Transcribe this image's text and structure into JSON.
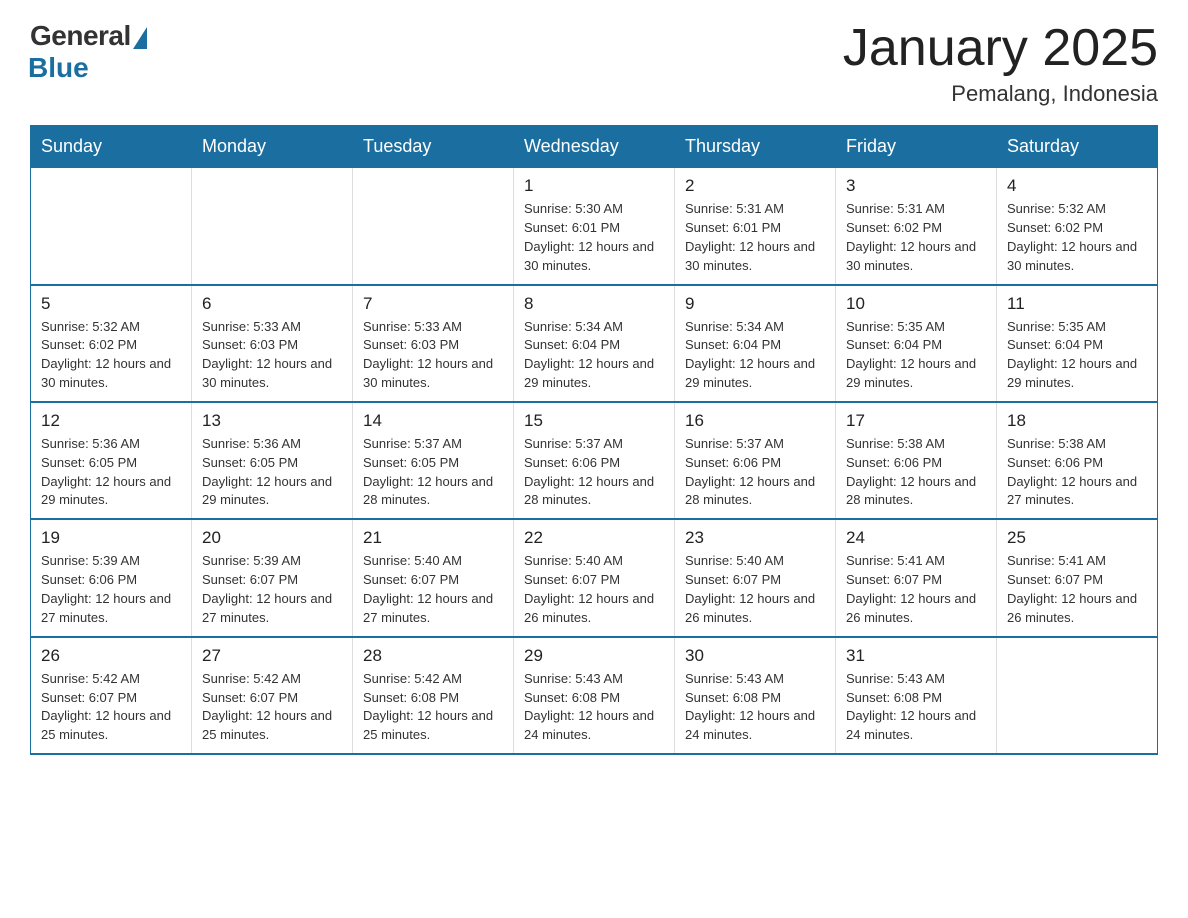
{
  "header": {
    "logo": {
      "general": "General",
      "blue": "Blue"
    },
    "title": "January 2025",
    "location": "Pemalang, Indonesia"
  },
  "calendar": {
    "days_of_week": [
      "Sunday",
      "Monday",
      "Tuesday",
      "Wednesday",
      "Thursday",
      "Friday",
      "Saturday"
    ],
    "weeks": [
      [
        {
          "day": "",
          "info": ""
        },
        {
          "day": "",
          "info": ""
        },
        {
          "day": "",
          "info": ""
        },
        {
          "day": "1",
          "info": "Sunrise: 5:30 AM\nSunset: 6:01 PM\nDaylight: 12 hours and 30 minutes."
        },
        {
          "day": "2",
          "info": "Sunrise: 5:31 AM\nSunset: 6:01 PM\nDaylight: 12 hours and 30 minutes."
        },
        {
          "day": "3",
          "info": "Sunrise: 5:31 AM\nSunset: 6:02 PM\nDaylight: 12 hours and 30 minutes."
        },
        {
          "day": "4",
          "info": "Sunrise: 5:32 AM\nSunset: 6:02 PM\nDaylight: 12 hours and 30 minutes."
        }
      ],
      [
        {
          "day": "5",
          "info": "Sunrise: 5:32 AM\nSunset: 6:02 PM\nDaylight: 12 hours and 30 minutes."
        },
        {
          "day": "6",
          "info": "Sunrise: 5:33 AM\nSunset: 6:03 PM\nDaylight: 12 hours and 30 minutes."
        },
        {
          "day": "7",
          "info": "Sunrise: 5:33 AM\nSunset: 6:03 PM\nDaylight: 12 hours and 30 minutes."
        },
        {
          "day": "8",
          "info": "Sunrise: 5:34 AM\nSunset: 6:04 PM\nDaylight: 12 hours and 29 minutes."
        },
        {
          "day": "9",
          "info": "Sunrise: 5:34 AM\nSunset: 6:04 PM\nDaylight: 12 hours and 29 minutes."
        },
        {
          "day": "10",
          "info": "Sunrise: 5:35 AM\nSunset: 6:04 PM\nDaylight: 12 hours and 29 minutes."
        },
        {
          "day": "11",
          "info": "Sunrise: 5:35 AM\nSunset: 6:04 PM\nDaylight: 12 hours and 29 minutes."
        }
      ],
      [
        {
          "day": "12",
          "info": "Sunrise: 5:36 AM\nSunset: 6:05 PM\nDaylight: 12 hours and 29 minutes."
        },
        {
          "day": "13",
          "info": "Sunrise: 5:36 AM\nSunset: 6:05 PM\nDaylight: 12 hours and 29 minutes."
        },
        {
          "day": "14",
          "info": "Sunrise: 5:37 AM\nSunset: 6:05 PM\nDaylight: 12 hours and 28 minutes."
        },
        {
          "day": "15",
          "info": "Sunrise: 5:37 AM\nSunset: 6:06 PM\nDaylight: 12 hours and 28 minutes."
        },
        {
          "day": "16",
          "info": "Sunrise: 5:37 AM\nSunset: 6:06 PM\nDaylight: 12 hours and 28 minutes."
        },
        {
          "day": "17",
          "info": "Sunrise: 5:38 AM\nSunset: 6:06 PM\nDaylight: 12 hours and 28 minutes."
        },
        {
          "day": "18",
          "info": "Sunrise: 5:38 AM\nSunset: 6:06 PM\nDaylight: 12 hours and 27 minutes."
        }
      ],
      [
        {
          "day": "19",
          "info": "Sunrise: 5:39 AM\nSunset: 6:06 PM\nDaylight: 12 hours and 27 minutes."
        },
        {
          "day": "20",
          "info": "Sunrise: 5:39 AM\nSunset: 6:07 PM\nDaylight: 12 hours and 27 minutes."
        },
        {
          "day": "21",
          "info": "Sunrise: 5:40 AM\nSunset: 6:07 PM\nDaylight: 12 hours and 27 minutes."
        },
        {
          "day": "22",
          "info": "Sunrise: 5:40 AM\nSunset: 6:07 PM\nDaylight: 12 hours and 26 minutes."
        },
        {
          "day": "23",
          "info": "Sunrise: 5:40 AM\nSunset: 6:07 PM\nDaylight: 12 hours and 26 minutes."
        },
        {
          "day": "24",
          "info": "Sunrise: 5:41 AM\nSunset: 6:07 PM\nDaylight: 12 hours and 26 minutes."
        },
        {
          "day": "25",
          "info": "Sunrise: 5:41 AM\nSunset: 6:07 PM\nDaylight: 12 hours and 26 minutes."
        }
      ],
      [
        {
          "day": "26",
          "info": "Sunrise: 5:42 AM\nSunset: 6:07 PM\nDaylight: 12 hours and 25 minutes."
        },
        {
          "day": "27",
          "info": "Sunrise: 5:42 AM\nSunset: 6:07 PM\nDaylight: 12 hours and 25 minutes."
        },
        {
          "day": "28",
          "info": "Sunrise: 5:42 AM\nSunset: 6:08 PM\nDaylight: 12 hours and 25 minutes."
        },
        {
          "day": "29",
          "info": "Sunrise: 5:43 AM\nSunset: 6:08 PM\nDaylight: 12 hours and 24 minutes."
        },
        {
          "day": "30",
          "info": "Sunrise: 5:43 AM\nSunset: 6:08 PM\nDaylight: 12 hours and 24 minutes."
        },
        {
          "day": "31",
          "info": "Sunrise: 5:43 AM\nSunset: 6:08 PM\nDaylight: 12 hours and 24 minutes."
        },
        {
          "day": "",
          "info": ""
        }
      ]
    ]
  }
}
